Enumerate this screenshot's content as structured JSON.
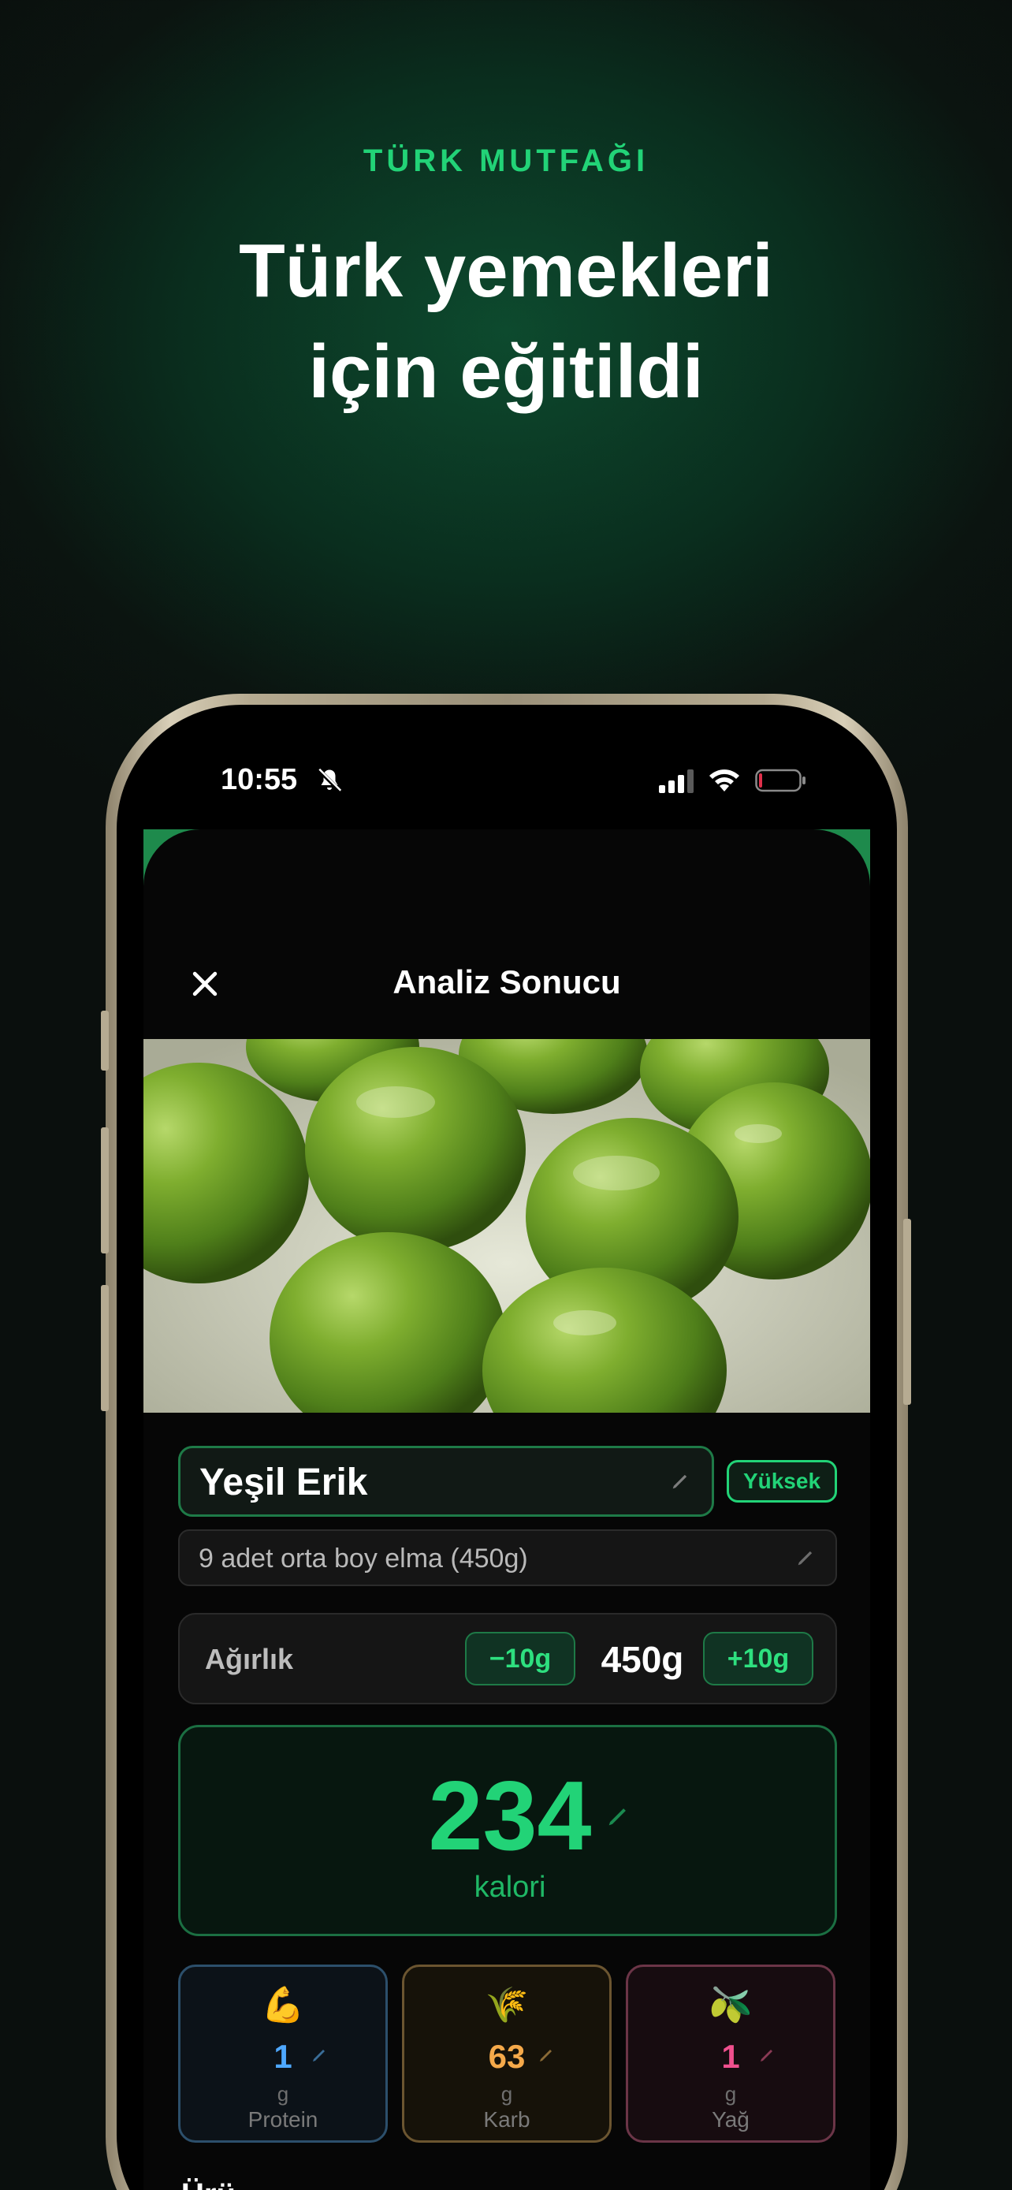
{
  "promo": {
    "eyebrow": "TÜRK MUTFAĞI",
    "title_line1": "Türk yemekleri",
    "title_line2": "için eğitildi"
  },
  "status_bar": {
    "time": "10:55",
    "icons": [
      "bell-slash-icon",
      "cellular-signal-icon",
      "wifi-icon",
      "battery-icon"
    ]
  },
  "sheet": {
    "title": "Analiz Sonucu",
    "close_icon": "close-icon"
  },
  "food": {
    "name": "Yeşil Erik",
    "confidence_badge": "Yüksek",
    "description": "9 adet orta boy elma (450g)"
  },
  "weight": {
    "label": "Ağırlık",
    "decrement_label": "−10g",
    "value": "450g",
    "increment_label": "+10g"
  },
  "calories": {
    "value": "234",
    "unit": "kalori"
  },
  "macros": [
    {
      "emoji": "💪",
      "value": "1",
      "unit": "g",
      "label": "Protein",
      "color": "#4ea8ff",
      "border": "#2c4f6b"
    },
    {
      "emoji": "🌾",
      "value": "63",
      "unit": "g",
      "label": "Karb",
      "color": "#f5a94a",
      "border": "#6b5530"
    },
    {
      "emoji": "🫒",
      "value": "1",
      "unit": "g",
      "label": "Yağ",
      "color": "#f0508e",
      "border": "#6b3547"
    }
  ],
  "section_peek": "Ürü",
  "colors": {
    "accent": "#22d377",
    "background": "#0a0f0d"
  }
}
